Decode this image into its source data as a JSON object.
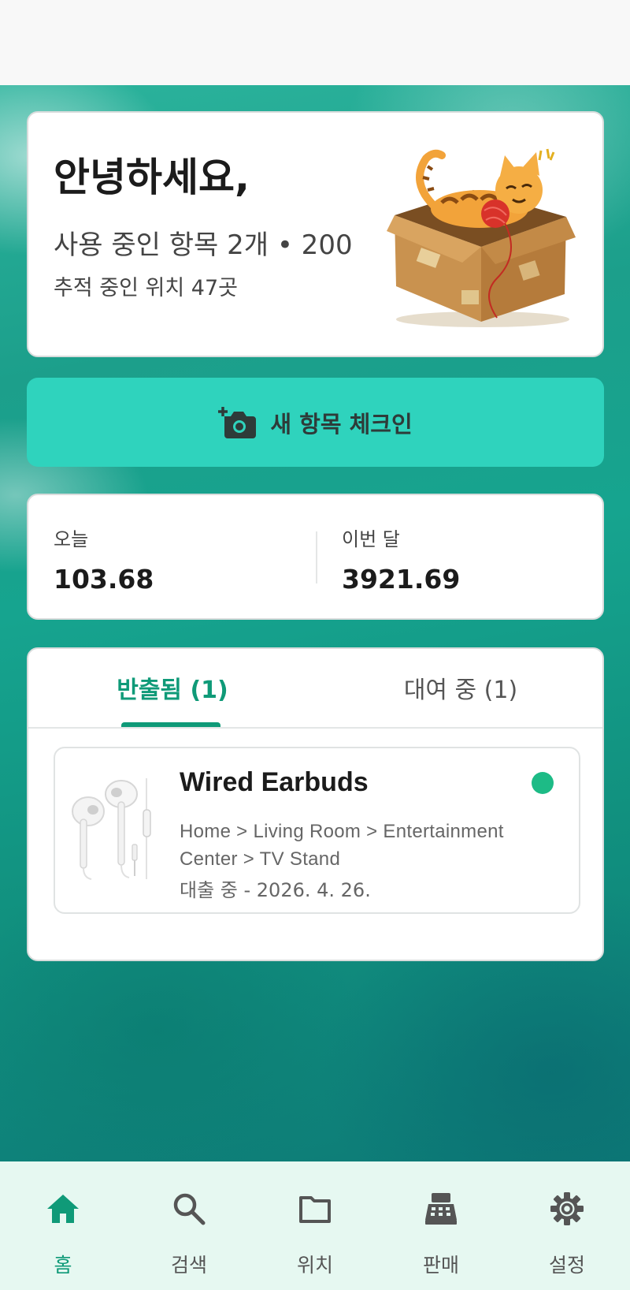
{
  "greeting": {
    "title": "안녕하세요,",
    "items_in_use": "사용 중인 항목 2개 • 200",
    "locations_tracked": "추적 중인 위치 47곳"
  },
  "checkin_button": {
    "label": "새 항목 체크인",
    "icon": "add-camera-icon"
  },
  "stats": {
    "today_label": "오늘",
    "today_value": "103.68",
    "month_label": "이번 달",
    "month_value": "3921.69"
  },
  "tabs": [
    {
      "label": "반출됨 (1)",
      "active": true
    },
    {
      "label": "대여 중 (1)",
      "active": false
    }
  ],
  "items": [
    {
      "title": "Wired Earbuds",
      "path": "Home > Living Room > Entertainment Center > TV Stand",
      "status": "대출 중 - 2026. 4. 26.",
      "status_color": "#1dbb86"
    }
  ],
  "bottom_nav": [
    {
      "label": "홈",
      "icon": "home-icon",
      "active": true
    },
    {
      "label": "검색",
      "icon": "search-icon",
      "active": false
    },
    {
      "label": "위치",
      "icon": "folder-icon",
      "active": false
    },
    {
      "label": "판매",
      "icon": "cash-register-icon",
      "active": false
    },
    {
      "label": "설정",
      "icon": "gear-icon",
      "active": false
    }
  ],
  "colors": {
    "accent": "#0f9a78",
    "checkin_bg": "#2fd3bd",
    "nav_bg": "#e6f8f1"
  }
}
